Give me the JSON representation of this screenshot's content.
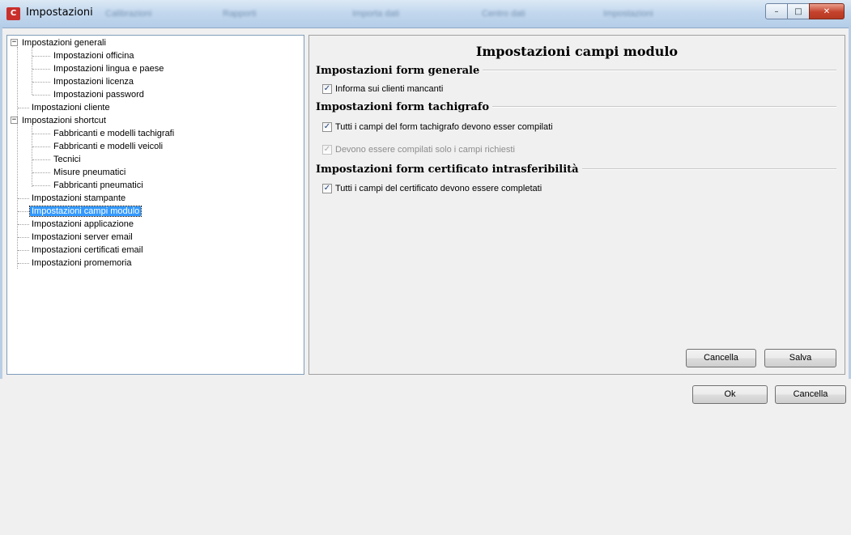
{
  "window": {
    "title": "Impostazioni",
    "background_tabs": [
      "Calibrazioni",
      "Rapporti",
      "Importa dati",
      "Centro dati",
      "Impostazioni"
    ],
    "controls": {
      "minimize": "–",
      "maximize": "□",
      "close": "✕"
    }
  },
  "tree": {
    "items": [
      {
        "label": "Impostazioni generali",
        "expander": "−"
      },
      {
        "label": "Impostazioni officina"
      },
      {
        "label": "Impostazioni lingua e paese"
      },
      {
        "label": "Impostazioni licenza"
      },
      {
        "label": "Impostazioni password"
      },
      {
        "label": "Impostazioni cliente"
      },
      {
        "label": "Impostazioni shortcut",
        "expander": "−"
      },
      {
        "label": "Fabbricanti e modelli tachigrafi"
      },
      {
        "label": "Fabbricanti e modelli veicoli"
      },
      {
        "label": "Tecnici"
      },
      {
        "label": "Misure pneumatici"
      },
      {
        "label": "Fabbricanti pneumatici"
      },
      {
        "label": "Impostazioni stampante"
      },
      {
        "label": "Impostazioni campi modulo",
        "selected": true
      },
      {
        "label": "Impostazioni applicazione"
      },
      {
        "label": "Impostazioni server email"
      },
      {
        "label": "Impostazioni certificati email"
      },
      {
        "label": "Impostazioni promemoria"
      }
    ]
  },
  "panel": {
    "title": "Impostazioni campi modulo",
    "sections": [
      {
        "heading": "Impostazioni form generale",
        "options": [
          {
            "label": "Informa sui clienti mancanti",
            "checked": true,
            "enabled": true
          }
        ]
      },
      {
        "heading": "Impostazioni form tachigrafo",
        "options": [
          {
            "label": "Tutti i campi del form tachigrafo devono esser compilati",
            "checked": true,
            "enabled": true
          },
          {
            "label": "Devono essere compilati solo i campi richiesti",
            "checked": true,
            "enabled": false
          }
        ]
      },
      {
        "heading": "Impostazioni form certificato intrasferibilità",
        "options": [
          {
            "label": "Tutti i campi del certificato devono essere completati",
            "checked": true,
            "enabled": true
          }
        ]
      }
    ],
    "cancel_label": "Cancella",
    "save_label": "Salva"
  },
  "footer": {
    "ok_label": "Ok",
    "cancel_label": "Cancella"
  },
  "check_glyph": "✓"
}
